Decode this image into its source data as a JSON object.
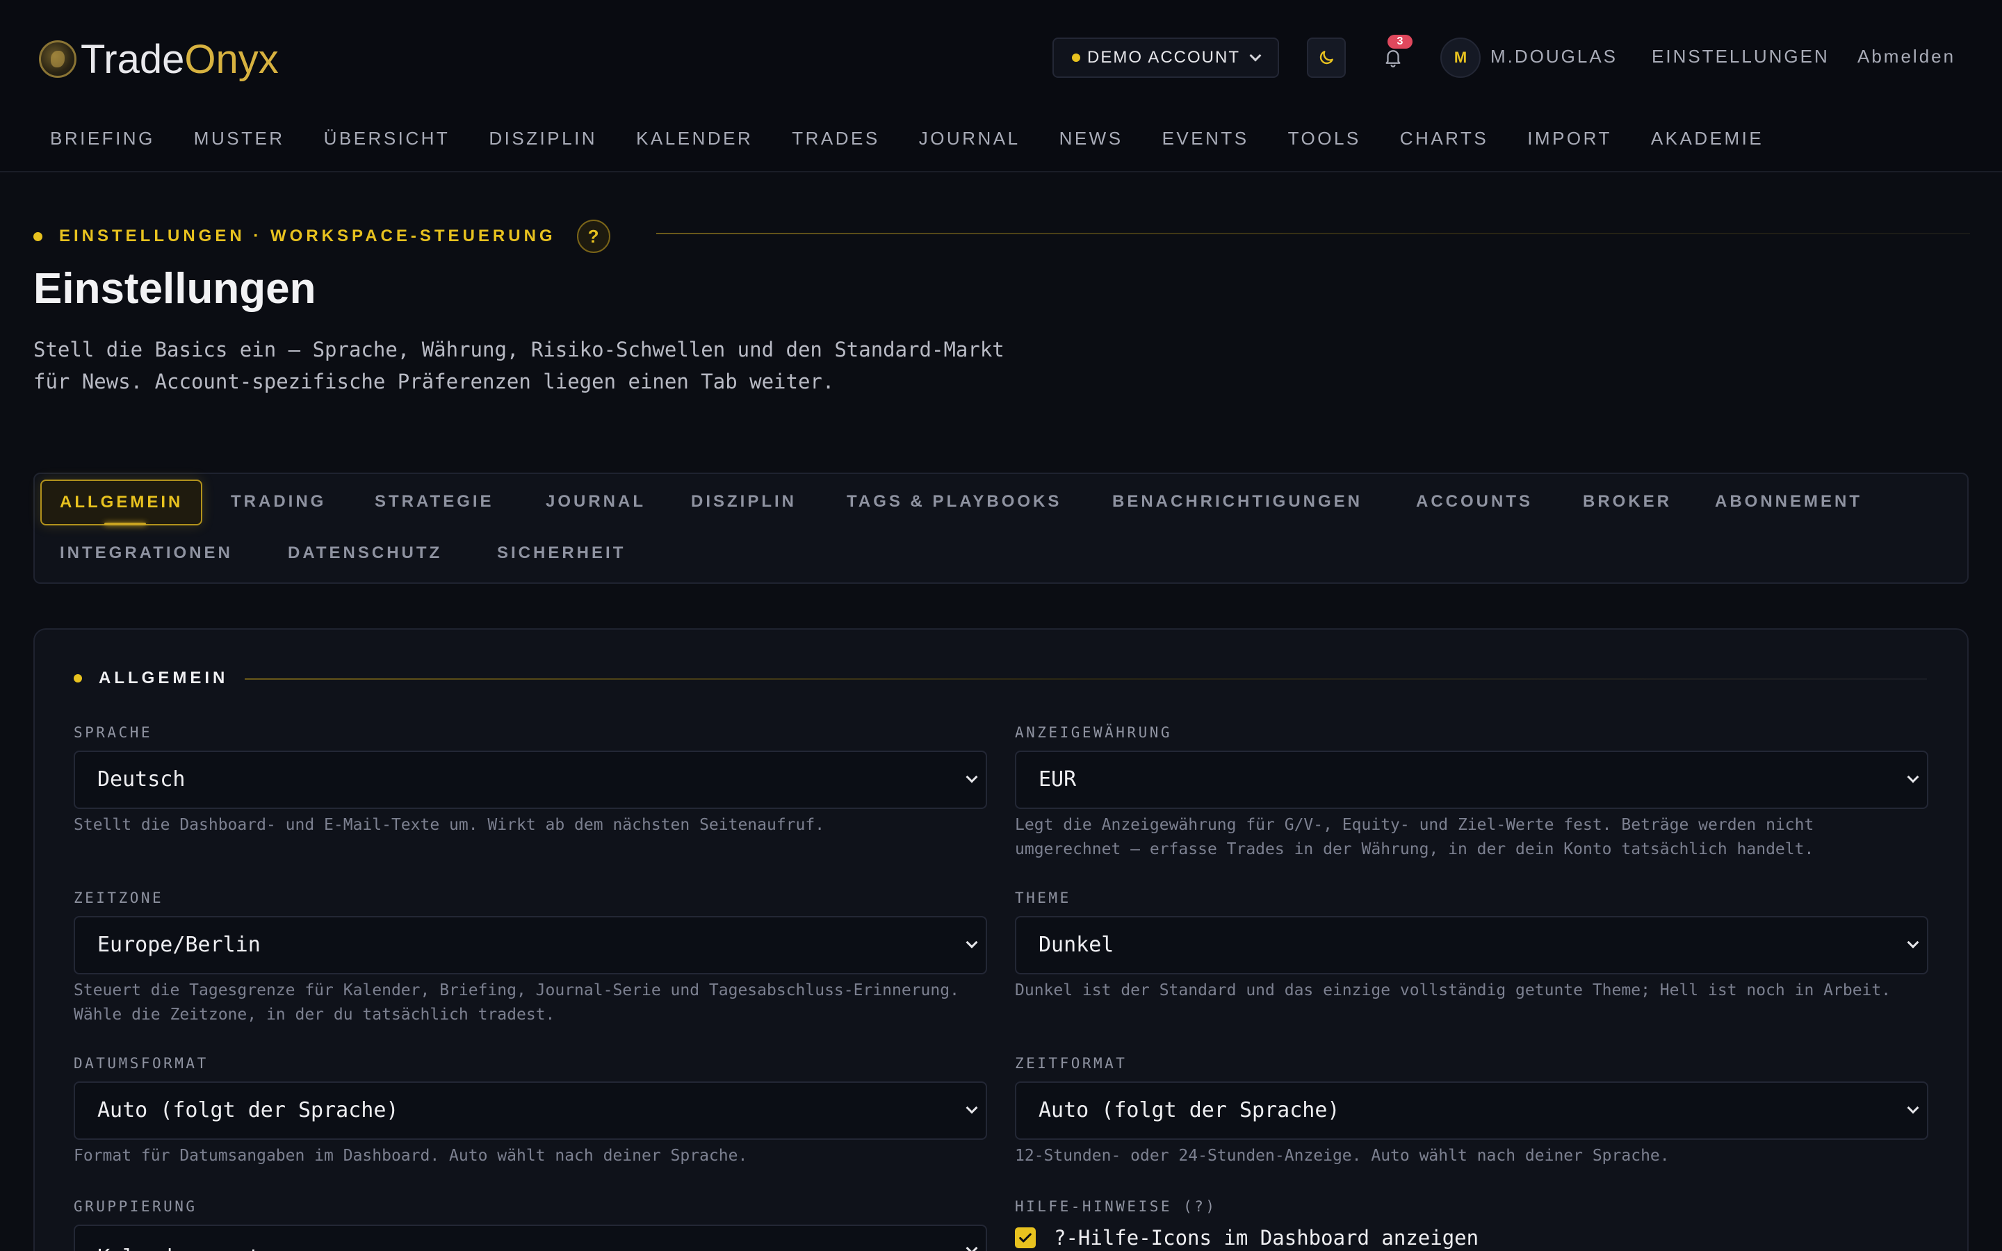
{
  "brand": {
    "name_part1": "Trade",
    "name_part2": "Onyx"
  },
  "header": {
    "account": "DEMO ACCOUNT",
    "notifications": "3",
    "avatar_initial": "M",
    "user": "M.DOUGLAS",
    "settings": "EINSTELLUNGEN",
    "logout": "Abmelden"
  },
  "nav": [
    "BRIEFING",
    "MUSTER",
    "ÜBERSICHT",
    "DISZIPLIN",
    "KALENDER",
    "TRADES",
    "JOURNAL",
    "NEWS",
    "EVENTS",
    "TOOLS",
    "CHARTS",
    "IMPORT",
    "AKADEMIE"
  ],
  "page": {
    "eyebrow": "EINSTELLUNGEN · WORKSPACE-STEUERUNG",
    "help": "?",
    "title": "Einstellungen",
    "subtitle": "Stell die Basics ein — Sprache, Währung, Risiko-Schwellen und den Standard-Markt für News. Account-spezifische Präferenzen liegen einen Tab weiter."
  },
  "tabs": [
    "ALLGEMEIN",
    "TRADING",
    "STRATEGIE",
    "JOURNAL",
    "DISZIPLIN",
    "TAGS & PLAYBOOKS",
    "BENACHRICHTIGUNGEN",
    "ACCOUNTS",
    "BROKER",
    "ABONNEMENT",
    "INTEGRATIONEN",
    "DATENSCHUTZ",
    "SICHERHEIT"
  ],
  "section": {
    "title": "ALLGEMEIN",
    "fields": {
      "language": {
        "label": "SPRACHE",
        "value": "Deutsch",
        "help": "Stellt die Dashboard- und E-Mail-Texte um. Wirkt ab dem nächsten Seitenaufruf."
      },
      "currency": {
        "label": "ANZEIGEWÄHRUNG",
        "value": "EUR",
        "help": "Legt die Anzeigewährung für G/V-, Equity- und Ziel-Werte fest. Beträge werden nicht umgerechnet — erfasse Trades in der Währung, in der dein Konto tatsächlich handelt."
      },
      "timezone": {
        "label": "ZEITZONE",
        "value": "Europe/Berlin",
        "help": "Steuert die Tagesgrenze für Kalender, Briefing, Journal-Serie und Tagesabschluss-Erinnerung. Wähle die Zeitzone, in der du tatsächlich tradest."
      },
      "theme": {
        "label": "THEME",
        "value": "Dunkel",
        "help": "Dunkel ist der Standard und das einzige vollständig getunte Theme; Hell ist noch in Arbeit."
      },
      "date_format": {
        "label": "DATUMSFORMAT",
        "value": "Auto (folgt der Sprache)",
        "help": "Format für Datumsangaben im Dashboard. Auto wählt nach deiner Sprache."
      },
      "time_format": {
        "label": "ZEITFORMAT",
        "value": "Auto (folgt der Sprache)",
        "help": "12-Stunden- oder 24-Stunden-Anzeige. Auto wählt nach deiner Sprache."
      },
      "grouping": {
        "label": "GRUPPIERUNG",
        "value": "Kalendermonat"
      },
      "help_hints": {
        "label": "HILFE-HINWEISE (?)",
        "checkbox_label": "?-Hilfe-Icons im Dashboard anzeigen",
        "checked": true
      }
    }
  },
  "colors": {
    "accent": "#e8c21f",
    "background": "#0b0d13",
    "panel": "#0f121a"
  }
}
